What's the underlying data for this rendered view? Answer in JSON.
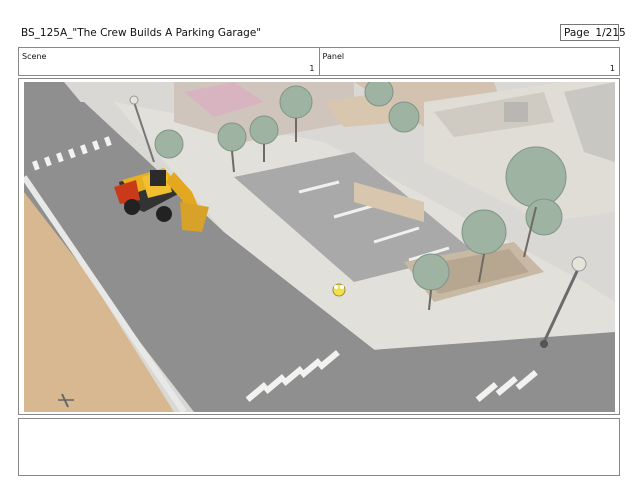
{
  "header": {
    "title": "BS_125A_\"The Crew Builds A Parking Garage\"",
    "page_label": "Page",
    "page_value": "1/215"
  },
  "info": {
    "scene_label": "Scene",
    "scene_value": "1",
    "panel_label": "Panel",
    "panel_value": "1"
  },
  "panel": {
    "description_icon": "storyboard-panel-image"
  },
  "notes": {
    "text": ""
  }
}
